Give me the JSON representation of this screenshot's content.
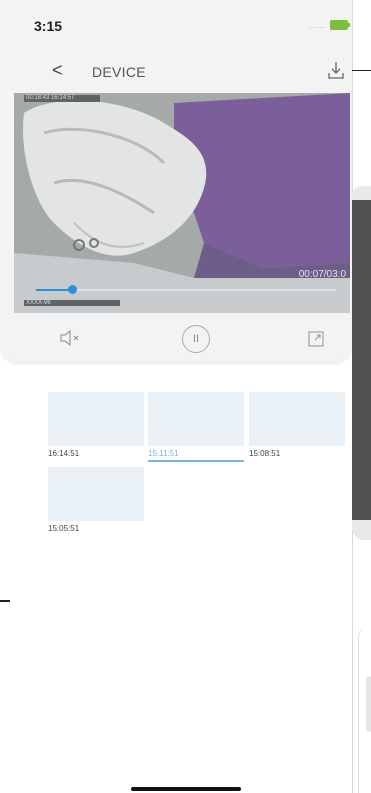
{
  "status_bar": {
    "time": "3:15",
    "signal": "....."
  },
  "nav": {
    "back_label": "<",
    "title": "DEVICE",
    "download_icon": "download-icon"
  },
  "video": {
    "time_readout": "00:07/03:0",
    "progress": 0.12,
    "osd_top": "00:18:43 16:14:57",
    "osd_bottom": "XXXX-96"
  },
  "controls": {
    "mute_icon": "speaker-muted-icon",
    "pause_icon": "pause-icon",
    "fullscreen_icon": "fullscreen-icon",
    "pause_glyph": "II"
  },
  "recordings": [
    {
      "time": "16:14:51",
      "selected": false
    },
    {
      "time": "15:11:51",
      "selected": true
    },
    {
      "time": "15:08:51",
      "selected": false
    },
    {
      "time": "15:05:51",
      "selected": false
    }
  ],
  "colors": {
    "accent": "#2a8fd6",
    "selected_label": "#7ab4de",
    "thumbnail_bg": "#eaf1f6",
    "battery": "#7bbf3c",
    "panel_bg": "#f3f3f3"
  }
}
